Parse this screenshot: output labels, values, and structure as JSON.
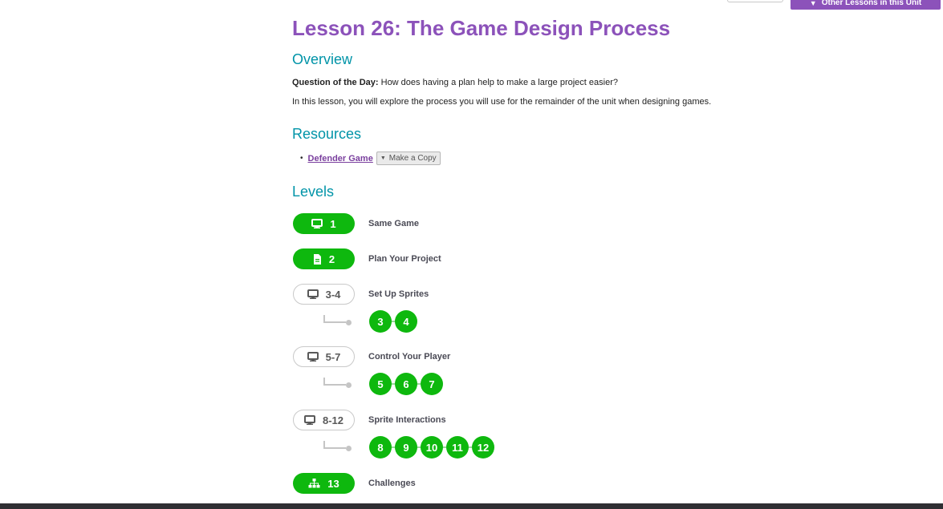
{
  "header": {
    "other_lessons_label": "Other Lessons in this Unit",
    "accent_color": "#8c52ba"
  },
  "lesson": {
    "title": "Lesson 26: The Game Design Process",
    "overview_heading": "Overview",
    "qotd_label": "Question of the Day:",
    "qotd_text": "How does having a plan help to make a large project easier?",
    "intro_text": "In this lesson, you will explore the process you will use for the remainder of the unit when designing games."
  },
  "resources": {
    "heading": "Resources",
    "items": [
      {
        "label": "Defender Game",
        "copy_label": "Make a Copy"
      }
    ]
  },
  "levels": {
    "heading": "Levels",
    "items": [
      {
        "number": "1",
        "label": "Same Game",
        "icon": "desktop-icon",
        "style": "filled",
        "sublevels": []
      },
      {
        "number": "2",
        "label": "Plan Your Project",
        "icon": "document-icon",
        "style": "filled",
        "sublevels": []
      },
      {
        "number": "3-4",
        "label": "Set Up Sprites",
        "icon": "desktop-icon",
        "style": "outline",
        "sublevels": [
          "3",
          "4"
        ]
      },
      {
        "number": "5-7",
        "label": "Control Your Player",
        "icon": "desktop-icon",
        "style": "outline",
        "sublevels": [
          "5",
          "6",
          "7"
        ]
      },
      {
        "number": "8-12",
        "label": "Sprite Interactions",
        "icon": "desktop-icon",
        "style": "outline",
        "sublevels": [
          "8",
          "9",
          "10",
          "11",
          "12"
        ]
      },
      {
        "number": "13",
        "label": "Challenges",
        "icon": "sitemap-icon",
        "style": "filled",
        "sublevels": []
      }
    ],
    "complete_color": "#0eb80e"
  }
}
